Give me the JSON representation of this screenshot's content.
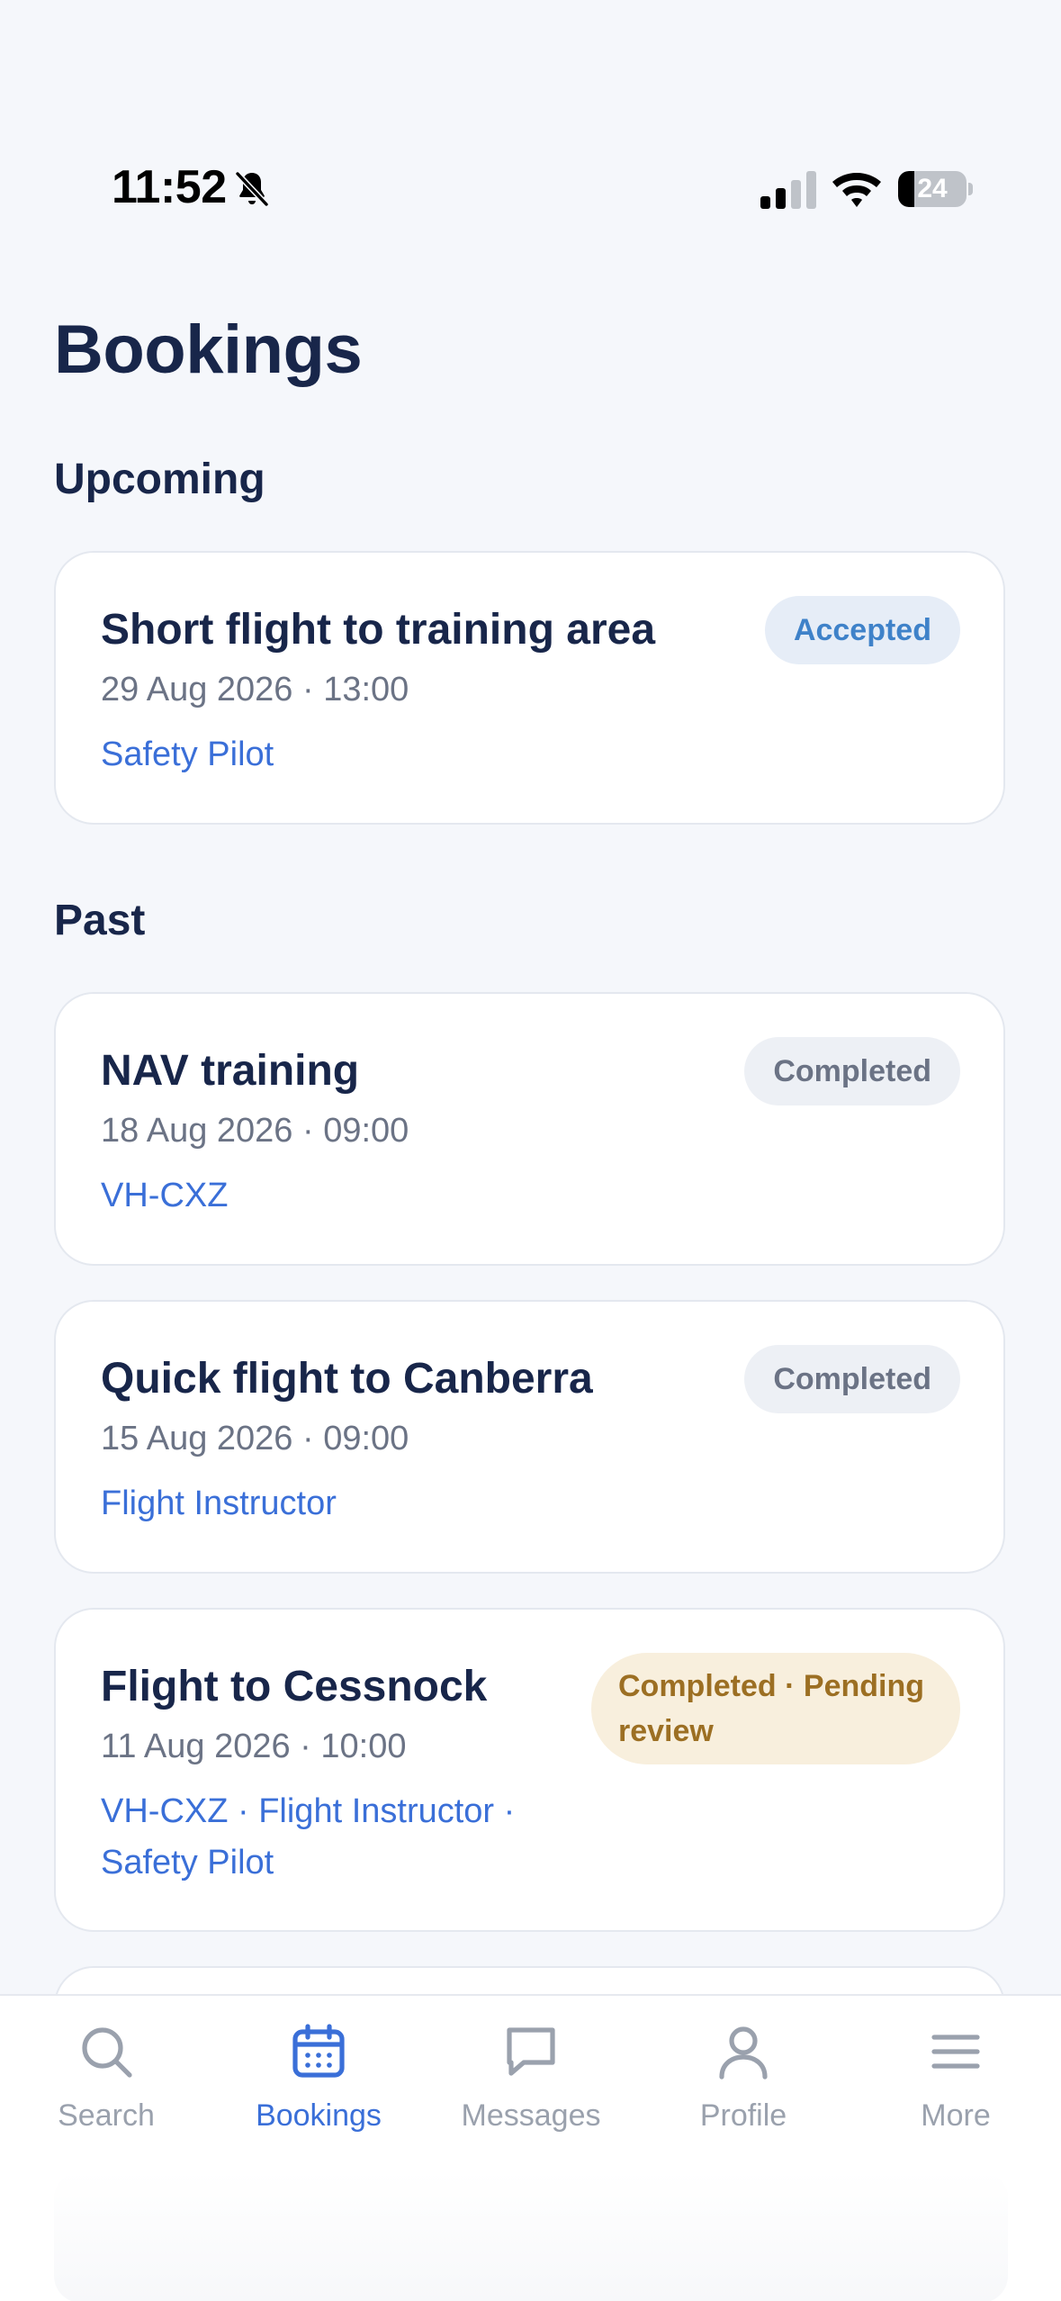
{
  "status_bar": {
    "time": "11:52",
    "battery_level": "24",
    "battery_fraction": 0.24
  },
  "page": {
    "title": "Bookings"
  },
  "sections": {
    "upcoming": "Upcoming",
    "past": "Past"
  },
  "upcoming_bookings": [
    {
      "title": "Short flight to training area",
      "date": "29 Aug 2026 · 13:00",
      "meta": "Safety Pilot",
      "status": "Accepted"
    }
  ],
  "past_bookings": [
    {
      "title": "NAV training",
      "date": "18 Aug 2026 · 09:00",
      "meta": "VH-CXZ",
      "status": "Completed"
    },
    {
      "title": "Quick flight to Canberra",
      "date": "15 Aug 2026 · 09:00",
      "meta": "Flight Instructor",
      "status": "Completed"
    },
    {
      "title": "Flight to Cessnock",
      "date": "11 Aug 2026 · 10:00",
      "meta": "VH-CXZ · Flight Instructor · Safety Pilot",
      "status": "Completed · Pending review"
    }
  ],
  "tab_bar": {
    "items": [
      {
        "label": "Search",
        "icon": "search-icon"
      },
      {
        "label": "Bookings",
        "icon": "calendar-icon",
        "active": true
      },
      {
        "label": "Messages",
        "icon": "message-icon"
      },
      {
        "label": "Profile",
        "icon": "person-icon"
      },
      {
        "label": "More",
        "icon": "menu-icon"
      }
    ]
  },
  "colors": {
    "accent": "#3a6fd8",
    "title": "#18264a",
    "accepted_badge": "#3f82c9",
    "pending_badge": "#9c6f23"
  }
}
